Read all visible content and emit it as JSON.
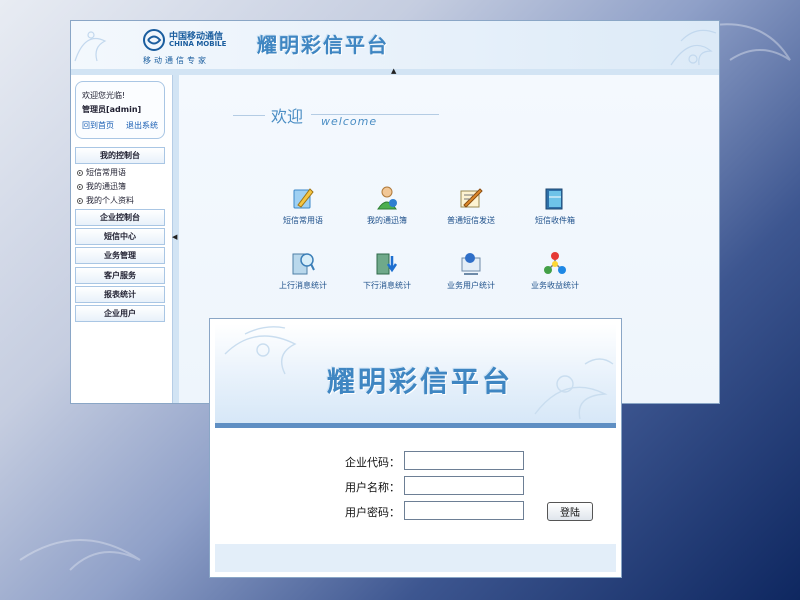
{
  "header": {
    "logo_cn": "中国移动通信",
    "logo_en": "CHINA MOBILE",
    "logo_sub": "移动通信专家",
    "title": "耀明彩信平台"
  },
  "sidebar": {
    "welcome": "欢迎您光临!",
    "admin": "管理员[admin]",
    "home_link": "回到首页",
    "logout_link": "退出系统",
    "menu": [
      "我的控制台",
      "企业控制台",
      "短信中心",
      "业务管理",
      "客户服务",
      "报表统计",
      "企业用户"
    ],
    "subitems": [
      "短信常用语",
      "我的通迅簿",
      "我的个人资料"
    ]
  },
  "content": {
    "welcome_cn": "欢迎",
    "welcome_en": "welcome",
    "tiles": [
      {
        "label": "短信常用语",
        "icon": "pen-icon"
      },
      {
        "label": "我的通迅簿",
        "icon": "contacts-icon"
      },
      {
        "label": "普通短信发送",
        "icon": "send-icon"
      },
      {
        "label": "短信收件箱",
        "icon": "inbox-icon"
      },
      {
        "label": "上行消息统计",
        "icon": "upload-stats-icon"
      },
      {
        "label": "下行消息统计",
        "icon": "download-stats-icon"
      },
      {
        "label": "业务用户统计",
        "icon": "users-stats-icon"
      },
      {
        "label": "业务收益统计",
        "icon": "revenue-stats-icon"
      }
    ]
  },
  "login": {
    "title": "耀明彩信平台",
    "company_code_label": "企业代码：",
    "username_label": "用户名称：",
    "password_label": "用户密码：",
    "company_code_value": "",
    "username_value": "",
    "password_value": "",
    "submit_label": "登陆"
  },
  "colors": {
    "accent": "#3f86c2",
    "link": "#1a5fb4",
    "border": "#8aa6c6",
    "bar": "#5f8fc3"
  }
}
